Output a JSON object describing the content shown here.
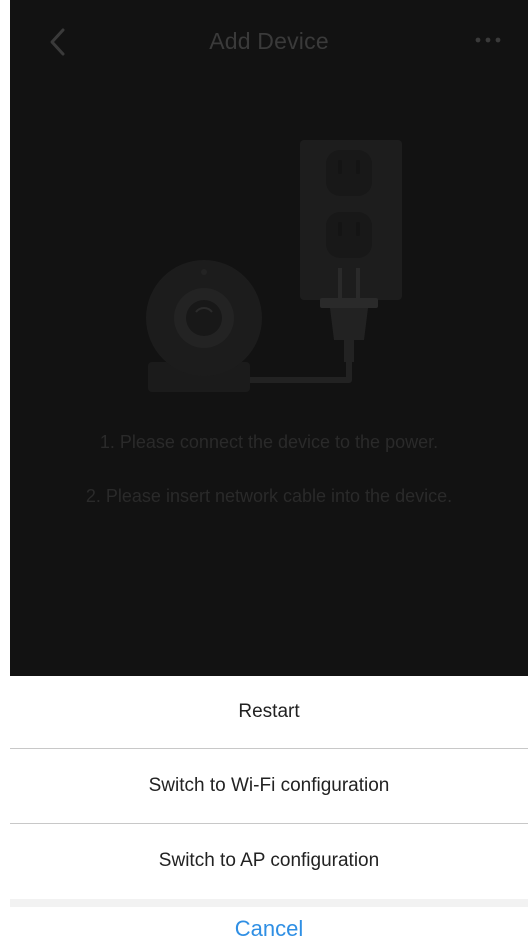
{
  "header": {
    "title": "Add Device",
    "back_icon": "chevron-left-icon",
    "more_icon": "more-dots-icon"
  },
  "main": {
    "illustration": "camera-plugged-into-outlet",
    "instructions": [
      "1. Please connect the device to the power.",
      "2. Please insert network cable into the device."
    ]
  },
  "action_sheet": {
    "items": [
      "Restart",
      "Switch to Wi-Fi configuration",
      "Switch to AP configuration"
    ],
    "cancel_label": "Cancel"
  },
  "colors": {
    "app_background": "#121212",
    "sheet_background": "#ffffff",
    "cancel_text": "#2f8fe4",
    "divider": "#c8c8c8"
  }
}
